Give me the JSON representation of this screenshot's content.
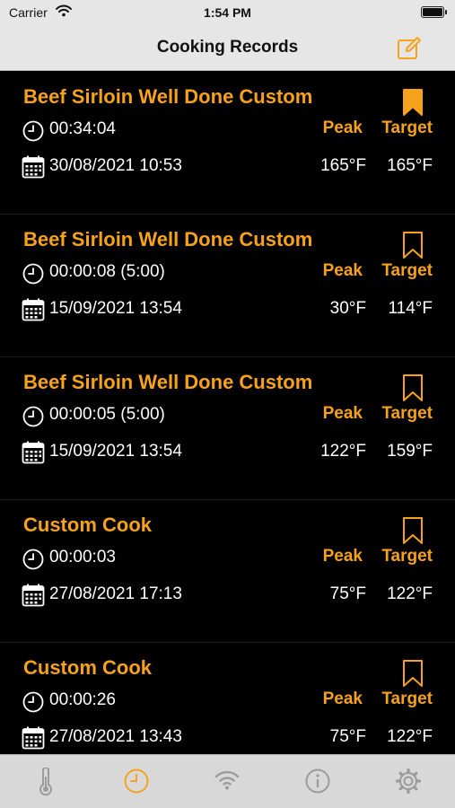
{
  "status": {
    "carrier": "Carrier",
    "time": "1:54 PM"
  },
  "header": {
    "title": "Cooking Records"
  },
  "colors": {
    "accent": "#f7a21b",
    "background": "#000000",
    "bar": "#e6e6e6"
  },
  "records": [
    {
      "title": "Beef Sirloin Well Done Custom",
      "duration": "00:34:04",
      "datetime": "30/08/2021 10:53",
      "peak_label": "Peak",
      "target_label": "Target",
      "peak": "165°F",
      "target": "165°F",
      "bookmarked": true
    },
    {
      "title": "Beef Sirloin Well Done Custom",
      "duration": "00:00:08 (5:00)",
      "datetime": "15/09/2021 13:54",
      "peak_label": "Peak",
      "target_label": "Target",
      "peak": "30°F",
      "target": "114°F",
      "bookmarked": false
    },
    {
      "title": "Beef Sirloin Well Done Custom",
      "duration": "00:00:05 (5:00)",
      "datetime": "15/09/2021 13:54",
      "peak_label": "Peak",
      "target_label": "Target",
      "peak": "122°F",
      "target": "159°F",
      "bookmarked": false
    },
    {
      "title": "Custom Cook",
      "duration": "00:00:03",
      "datetime": "27/08/2021 17:13",
      "peak_label": "Peak",
      "target_label": "Target",
      "peak": "75°F",
      "target": "122°F",
      "bookmarked": false
    },
    {
      "title": "Custom Cook",
      "duration": "00:00:26",
      "datetime": "27/08/2021 13:43",
      "peak_label": "Peak",
      "target_label": "Target",
      "peak": "75°F",
      "target": "122°F",
      "bookmarked": false
    }
  ],
  "tabs": [
    {
      "icon": "thermometer-icon",
      "active": false
    },
    {
      "icon": "clock-icon",
      "active": true
    },
    {
      "icon": "wifi-icon",
      "active": false
    },
    {
      "icon": "info-icon",
      "active": false
    },
    {
      "icon": "gear-icon",
      "active": false
    }
  ]
}
